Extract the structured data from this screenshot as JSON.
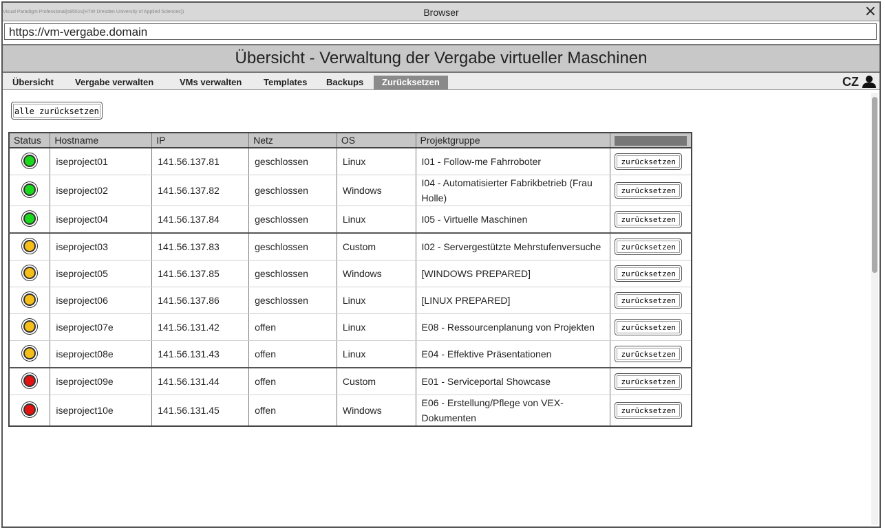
{
  "window": {
    "watermark": "Visual Paradigm Professional(s8551s(HTW Dresden University of Applied Sciences))",
    "title": "Browser",
    "close_icon": "×"
  },
  "browser": {
    "url": "https://vm-vergabe.domain"
  },
  "app": {
    "title": "Übersicht - Verwaltung der Vergabe virtueller Maschinen"
  },
  "nav": {
    "items": [
      {
        "label": "Übersicht",
        "active": false
      },
      {
        "label": "Vergabe verwalten",
        "active": false
      },
      {
        "label": "VMs verwalten",
        "active": false
      },
      {
        "label": "Templates",
        "active": false
      },
      {
        "label": "Backups",
        "active": false
      },
      {
        "label": "Zurücksetzen",
        "active": true
      }
    ],
    "language": "CZ",
    "user_icon": "user-icon"
  },
  "actions": {
    "reset_all_label": "alle zurücksetzen"
  },
  "table": {
    "headers": [
      "Status",
      "Hostname",
      "IP",
      "Netz",
      "OS",
      "Projektgruppe",
      ""
    ],
    "status_colors": {
      "green": "#1ad81a",
      "yellow": "#f6be18",
      "red": "#e31212"
    },
    "rows": [
      {
        "status": "green",
        "hostname": "iseproject01",
        "ip": "141.56.137.81",
        "netz": "geschlossen",
        "os": "Linux",
        "projekt": "I01 - Follow-me Fahrroboter",
        "action": "zurücksetzen"
      },
      {
        "status": "green",
        "hostname": "iseproject02",
        "ip": "141.56.137.82",
        "netz": "geschlossen",
        "os": "Windows",
        "projekt": "I04 - Automatisierter Fabrikbetrieb (Frau Holle)",
        "action": "zurücksetzen"
      },
      {
        "status": "green",
        "hostname": "iseproject04",
        "ip": "141.56.137.84",
        "netz": "geschlossen",
        "os": "Linux",
        "projekt": "I05 - Virtuelle Maschinen",
        "action": "zurücksetzen"
      },
      {
        "status": "yellow",
        "hostname": "iseproject03",
        "ip": "141.56.137.83",
        "netz": "geschlossen",
        "os": "Custom",
        "projekt": "I02 - Servergestützte Mehrstufenversuche",
        "action": "zurücksetzen"
      },
      {
        "status": "yellow",
        "hostname": "iseproject05",
        "ip": "141.56.137.85",
        "netz": "geschlossen",
        "os": "Windows",
        "projekt": "[WINDOWS PREPARED]",
        "action": "zurücksetzen"
      },
      {
        "status": "yellow",
        "hostname": "iseproject06",
        "ip": "141.56.137.86",
        "netz": "geschlossen",
        "os": "Linux",
        "projekt": "[LINUX PREPARED]",
        "action": "zurücksetzen"
      },
      {
        "status": "yellow",
        "hostname": "iseproject07e",
        "ip": "141.56.131.42",
        "netz": "offen",
        "os": "Linux",
        "projekt": "E08 - Ressourcenplanung von Projekten",
        "action": "zurücksetzen"
      },
      {
        "status": "yellow",
        "hostname": "iseproject08e",
        "ip": "141.56.131.43",
        "netz": "offen",
        "os": "Linux",
        "projekt": "E04 - Effektive Präsentationen",
        "action": "zurücksetzen"
      },
      {
        "status": "red",
        "hostname": "iseproject09e",
        "ip": "141.56.131.44",
        "netz": "offen",
        "os": "Custom",
        "projekt": "E01 - Serviceportal Showcase",
        "action": "zurücksetzen"
      },
      {
        "status": "red",
        "hostname": "iseproject10e",
        "ip": "141.56.131.45",
        "netz": "offen",
        "os": "Windows",
        "projekt": "E06 - Erstellung/Pflege von VEX-Dokumenten",
        "action": "zurücksetzen"
      }
    ]
  }
}
